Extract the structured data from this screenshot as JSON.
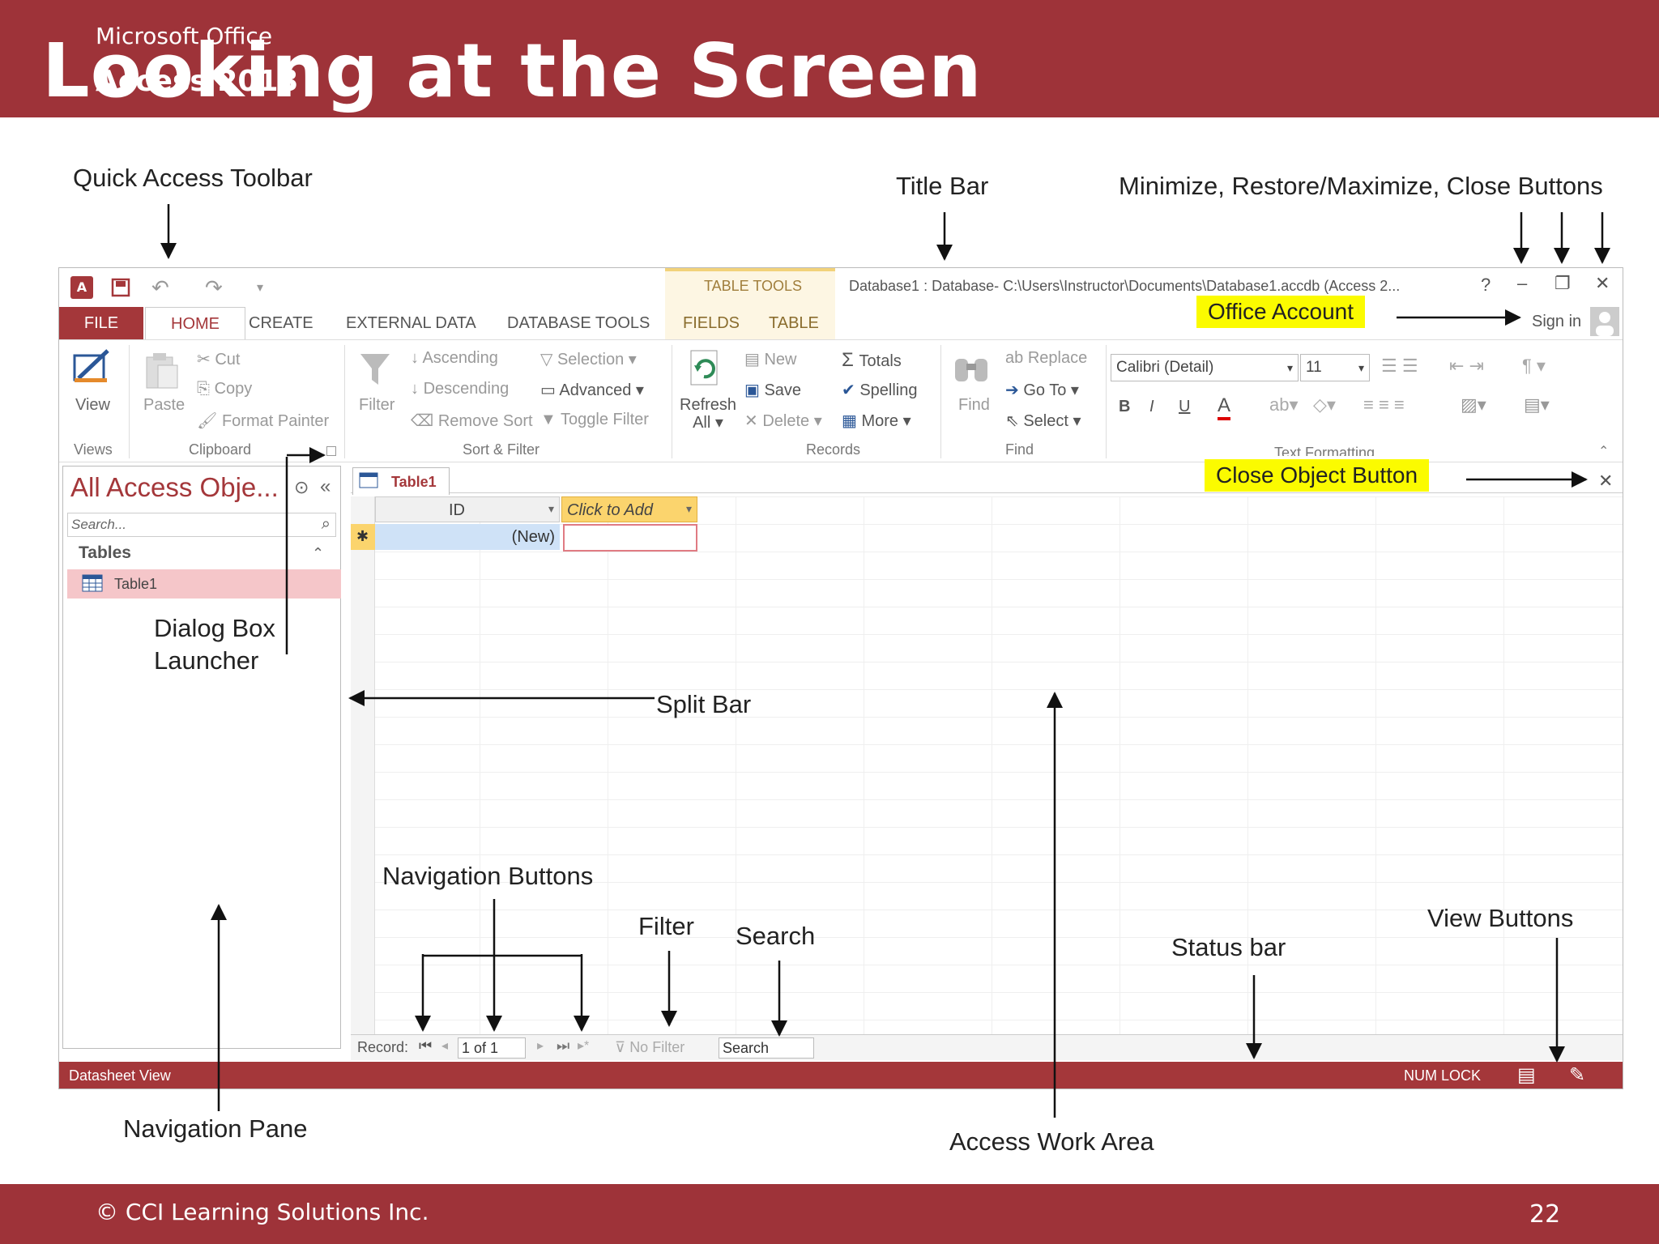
{
  "slide": {
    "brand_line1": "Microsoft Office",
    "brand_line2": "Access 2013",
    "title": "Looking at the Screen",
    "footer": "© CCI Learning Solutions Inc.",
    "page_number": "22"
  },
  "callouts": {
    "qat": "Quick Access Toolbar",
    "title_bar": "Title Bar",
    "window_buttons": "Minimize, Restore/Maximize, Close Buttons",
    "office_account": "Office Account",
    "close_object": "Close Object Button",
    "dialog_line1": "Dialog Box",
    "dialog_line2": "Launcher",
    "split_bar": "Split Bar",
    "nav_buttons": "Navigation Buttons",
    "filter": "Filter",
    "search": "Search",
    "status_bar": "Status bar",
    "view_buttons": "View Buttons",
    "nav_pane": "Navigation Pane",
    "work_area": "Access Work Area"
  },
  "window": {
    "table_tools": "TABLE TOOLS",
    "title": "Database1 : Database- C:\\Users\\Instructor\\Documents\\Database1.accdb (Access 2...",
    "help": "?",
    "minimize": "–",
    "restore": "❐",
    "close": "✕",
    "sign_in": "Sign in"
  },
  "tabs": [
    "FILE",
    "HOME",
    "CREATE",
    "EXTERNAL DATA",
    "DATABASE TOOLS",
    "FIELDS",
    "TABLE"
  ],
  "ribbon": {
    "view": "View",
    "paste": "Paste",
    "cut": "Cut",
    "copy": "Copy",
    "format_painter": "Format Painter",
    "filter": "Filter",
    "ascending": "Ascending",
    "descending": "Descending",
    "remove_sort": "Remove Sort",
    "selection": "Selection",
    "advanced": "Advanced",
    "toggle_filter": "Toggle Filter",
    "refresh1": "Refresh",
    "refresh2": "All",
    "new": "New",
    "save": "Save",
    "delete": "Delete",
    "totals": "Totals",
    "spelling": "Spelling",
    "more": "More",
    "find": "Find",
    "replace": "Replace",
    "goto": "Go To",
    "select": "Select",
    "font": "Calibri (Detail)",
    "size": "11",
    "bold": "B",
    "italic": "I",
    "underline": "U",
    "groups": {
      "views": "Views",
      "clipboard": "Clipboard",
      "sort_filter": "Sort & Filter",
      "records": "Records",
      "find": "Find",
      "text_formatting": "Text Formatting"
    }
  },
  "nav": {
    "header": "All Access Obje...",
    "search_placeholder": "Search...",
    "section": "Tables",
    "item": "Table1"
  },
  "doc": {
    "tab": "Table1",
    "col_id": "ID",
    "col_add": "Click to Add",
    "new_row": "(New)",
    "new_marker": "✱"
  },
  "recordbar": {
    "label": "Record:",
    "position": "1 of 1",
    "no_filter": "No Filter",
    "search": "Search"
  },
  "status": {
    "left": "Datasheet View",
    "numlock": "NUM LOCK"
  },
  "colors": {
    "accent": "#9e3339",
    "status": "#a4373a",
    "highlight": "#fbfb00",
    "nav_item": "#f5c6c9",
    "tools": "#fdf6e3"
  }
}
